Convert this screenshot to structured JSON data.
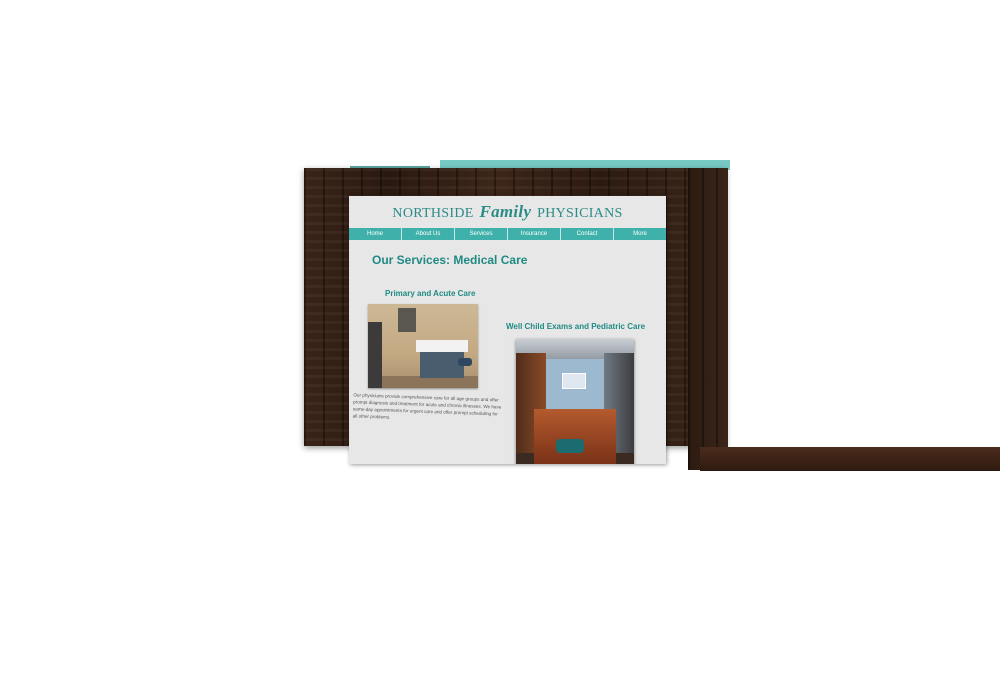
{
  "site": {
    "brand": {
      "part1": "NORTHSIDE",
      "script": "Family",
      "part2": "PHYSICIANS"
    },
    "nav": [
      "Home",
      "About Us",
      "Services",
      "Insurance",
      "Contact",
      "More"
    ],
    "page_title": "Our Services:  Medical Care",
    "sections": [
      {
        "heading": "Primary and Acute Care",
        "description": "Our physicians provide comprehensive care for all age groups and offer prompt diagnosis and treatment for acute and chronic illnesses. We have same-day appointments for urgent care and offer prompt scheduling for all other problems."
      },
      {
        "heading": "Well Child Exams and Pediatric Care"
      }
    ]
  },
  "colors": {
    "accent": "#3fb1aa",
    "heading": "#1f8a84",
    "wood": "#2e1b12",
    "page_bg": "#e7e7e7"
  }
}
